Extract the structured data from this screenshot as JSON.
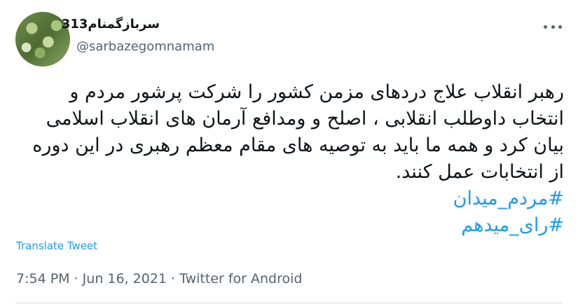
{
  "user": {
    "display_name": "سربازگمنام313",
    "handle": "@sarbazegomnamam",
    "avatar_icon": "leafy-avatar"
  },
  "tweet": {
    "text": "رهبر انقلاب علاج دردهای مزمن کشور را شرکت پرشور مردم و انتخاب داوطلب انقلابی ، اصلح و ومدافع آرمان های انقلاب اسلامی بیان کرد و همه ما باید به توصیه های مقام معظم رهبری در این دوره از انتخابات عمل کنند.",
    "hashtags": [
      "#مردم_میدان",
      "#رای_میدهم"
    ]
  },
  "translate_label": "Translate Tweet",
  "meta": {
    "time": "7:54 PM",
    "date": "Jun 16, 2021",
    "source": "Twitter for Android",
    "line": "7:54 PM · Jun 16, 2021 · Twitter for Android"
  },
  "colors": {
    "link": "#1d9bf0",
    "secondary_text": "#536471",
    "primary_text": "#0f1419"
  }
}
